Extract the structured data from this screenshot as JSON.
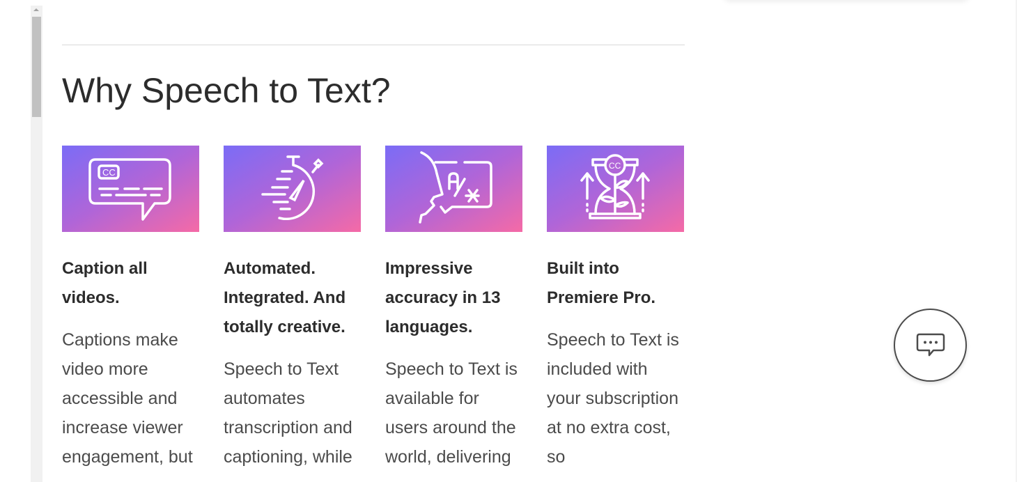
{
  "heading": "Why Speech to Text?",
  "gradient": {
    "from": "#7b6cf6",
    "to": "#f56aa6"
  },
  "features": [
    {
      "icon": "closed-caption-speech-bubble-icon",
      "title": "Caption all videos.",
      "body": "Captions make video more accessible and increase viewer engagement, but"
    },
    {
      "icon": "stopwatch-icon",
      "title": "Automated. Integrated. And totally creative.",
      "body": "Speech to Text automates transcription and captioning, while"
    },
    {
      "icon": "face-translation-icon",
      "title": "Impressive accuracy in 13 languages.",
      "body": "Speech to Text is available for users around the world, delivering"
    },
    {
      "icon": "hourglass-growth-icon",
      "title": "Built into Premiere Pro.",
      "body": "Speech to Text is included with your subscription at no extra cost, so"
    }
  ],
  "chat_button": {
    "icon": "chat-bubble-icon"
  }
}
